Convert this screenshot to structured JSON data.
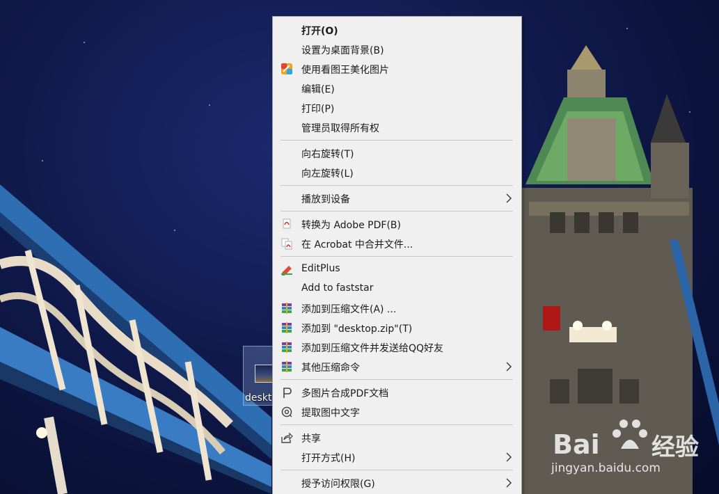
{
  "desktop": {
    "icon_label": "deskt"
  },
  "menu": {
    "items": [
      {
        "label": "打开(O)"
      },
      {
        "label": "设置为桌面背景(B)"
      },
      {
        "label": "使用看图王美化图片"
      },
      {
        "label": "编辑(E)"
      },
      {
        "label": "打印(P)"
      },
      {
        "label": "管理员取得所有权"
      },
      {
        "label": "向右旋转(T)"
      },
      {
        "label": "向左旋转(L)"
      },
      {
        "label": "播放到设备"
      },
      {
        "label": "转换为 Adobe PDF(B)"
      },
      {
        "label": "在 Acrobat 中合并文件..."
      },
      {
        "label": "EditPlus"
      },
      {
        "label": "Add to faststar"
      },
      {
        "label": "添加到压缩文件(A) ..."
      },
      {
        "label": "添加到 \"desktop.zip\"(T)"
      },
      {
        "label": "添加到压缩文件并发送给QQ好友"
      },
      {
        "label": "其他压缩命令"
      },
      {
        "label": "多图片合成PDF文档"
      },
      {
        "label": "提取图中文字"
      },
      {
        "label": "共享"
      },
      {
        "label": "打开方式(H)"
      },
      {
        "label": "授予访问权限(G)"
      }
    ]
  },
  "watermark": {
    "brand_latin": "Bai",
    "brand_cn": "经验",
    "url": "jingyan.baidu.com"
  },
  "colors": {
    "menu_bg": "#f0f0f0",
    "separator": "#c8c8c8",
    "sky": "#101a4c"
  }
}
